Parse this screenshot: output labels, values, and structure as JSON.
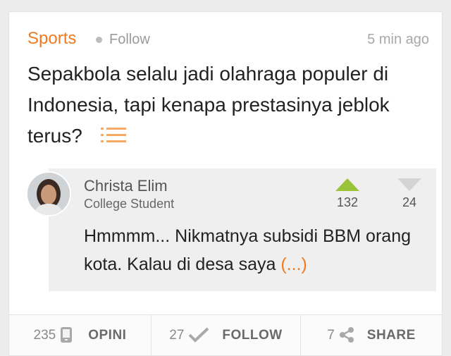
{
  "post": {
    "category": "Sports",
    "follow_label": "Follow",
    "time": "5 min ago",
    "headline": "Sepakbola selalu jadi olahraga populer di Indonesia, tapi kenapa prestasinya jeblok terus?"
  },
  "answer": {
    "author_name": "Christa Elim",
    "author_title": "College Student",
    "upvotes": "132",
    "downvotes": "24",
    "excerpt": "Hmmmm... Nikmatnya subsidi BBM orang kota. Kalau di desa saya",
    "more_label": "(...)"
  },
  "footer": {
    "opini_count": "235",
    "opini_label": "OPINI",
    "follow_count": "27",
    "follow_label": "FOLLOW",
    "share_count": "7",
    "share_label": "SHARE"
  },
  "colors": {
    "accent": "#f07a22",
    "upvote": "#9ac33a",
    "downvote": "#d4d4d4"
  }
}
